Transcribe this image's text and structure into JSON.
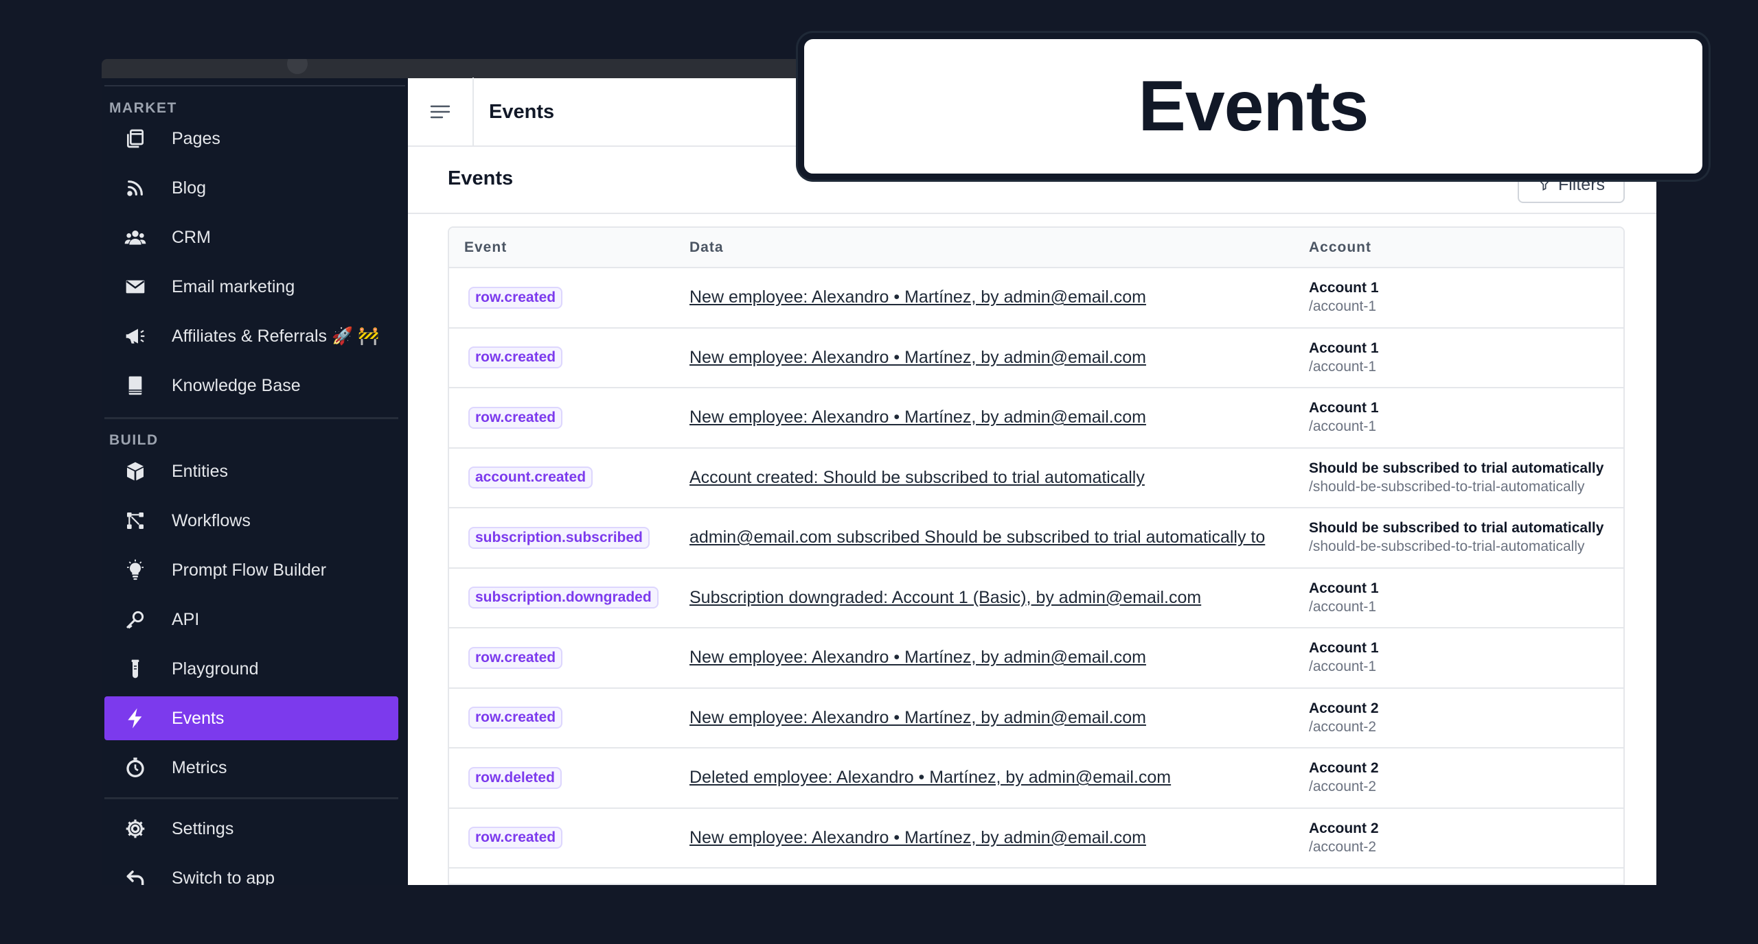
{
  "sidebar": {
    "sections": {
      "market": "MARKET",
      "build": "BUILD"
    },
    "market_items": [
      {
        "label": "Pages",
        "icon": "pages-icon"
      },
      {
        "label": "Blog",
        "icon": "rss-icon"
      },
      {
        "label": "CRM",
        "icon": "users-icon"
      },
      {
        "label": "Email marketing",
        "icon": "envelope-icon"
      },
      {
        "label": "Affiliates & Referrals 🚀 🚧",
        "icon": "megaphone-icon"
      },
      {
        "label": "Knowledge Base",
        "icon": "book-icon"
      }
    ],
    "build_items": [
      {
        "label": "Entities",
        "icon": "cube-icon"
      },
      {
        "label": "Workflows",
        "icon": "workflow-icon"
      },
      {
        "label": "Prompt Flow Builder",
        "icon": "lightbulb-icon"
      },
      {
        "label": "API",
        "icon": "key-icon"
      },
      {
        "label": "Playground",
        "icon": "test-tube-icon"
      },
      {
        "label": "Events",
        "icon": "lightning-icon",
        "active": true
      },
      {
        "label": "Metrics",
        "icon": "stopwatch-icon"
      }
    ],
    "bottom_items": [
      {
        "label": "Settings",
        "icon": "gear-icon"
      },
      {
        "label": "Switch to app",
        "icon": "undo-arrow-icon"
      }
    ]
  },
  "topbar": {
    "title": "Events"
  },
  "page": {
    "title": "Events",
    "filters_label": "Filters"
  },
  "table": {
    "headers": [
      "Event",
      "Data",
      "Account"
    ],
    "rows": [
      {
        "event": "row.created",
        "data": "New employee: Alexandro • Martínez, by admin@email.com",
        "account": "Account 1",
        "slug": "/account-1"
      },
      {
        "event": "row.created",
        "data": "New employee: Alexandro • Martínez, by admin@email.com",
        "account": "Account 1",
        "slug": "/account-1"
      },
      {
        "event": "row.created",
        "data": "New employee: Alexandro • Martínez, by admin@email.com",
        "account": "Account 1",
        "slug": "/account-1"
      },
      {
        "event": "account.created",
        "data": "Account created: Should be subscribed to trial automatically",
        "account": "Should be subscribed to trial automatically",
        "slug": "/should-be-subscribed-to-trial-automatically"
      },
      {
        "event": "subscription.subscribed",
        "data": "admin@email.com subscribed Should be subscribed to trial automatically to",
        "account": "Should be subscribed to trial automatically",
        "slug": "/should-be-subscribed-to-trial-automatically"
      },
      {
        "event": "subscription.downgraded",
        "data": "Subscription downgraded: Account 1 (Basic), by admin@email.com",
        "account": "Account 1",
        "slug": "/account-1"
      },
      {
        "event": "row.created",
        "data": "New employee: Alexandro • Martínez, by admin@email.com",
        "account": "Account 1",
        "slug": "/account-1"
      },
      {
        "event": "row.created",
        "data": "New employee: Alexandro • Martínez, by admin@email.com",
        "account": "Account 2",
        "slug": "/account-2"
      },
      {
        "event": "row.deleted",
        "data": "Deleted employee: Alexandro • Martínez, by admin@email.com",
        "account": "Account 2",
        "slug": "/account-2"
      },
      {
        "event": "row.created",
        "data": "New employee: Alexandro • Martínez, by admin@email.com",
        "account": "Account 2",
        "slug": "/account-2"
      }
    ]
  },
  "callout": {
    "text": "Events"
  },
  "colors": {
    "background": "#121827",
    "sidebar": "#111827",
    "accent": "#7c3aed"
  }
}
